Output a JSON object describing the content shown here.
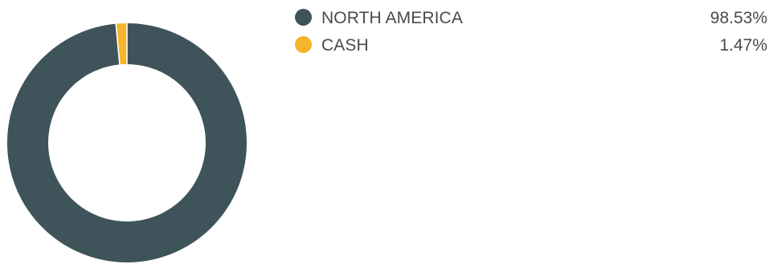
{
  "chart_data": {
    "type": "pie",
    "variant": "donut",
    "categories": [
      "NORTH AMERICA",
      "CASH"
    ],
    "values": [
      98.53,
      1.47
    ],
    "value_labels": [
      "98.53%",
      "1.47%"
    ],
    "colors": [
      "#3f535a",
      "#f6b42d"
    ],
    "legend_placement": "right",
    "start_angle_deg": 0,
    "direction": "clockwise"
  },
  "legend": {
    "items": [
      {
        "label": "NORTH AMERICA",
        "value": "98.53%",
        "color": "#3f535a"
      },
      {
        "label": "CASH",
        "value": "1.47%",
        "color": "#f6b42d"
      }
    ]
  }
}
